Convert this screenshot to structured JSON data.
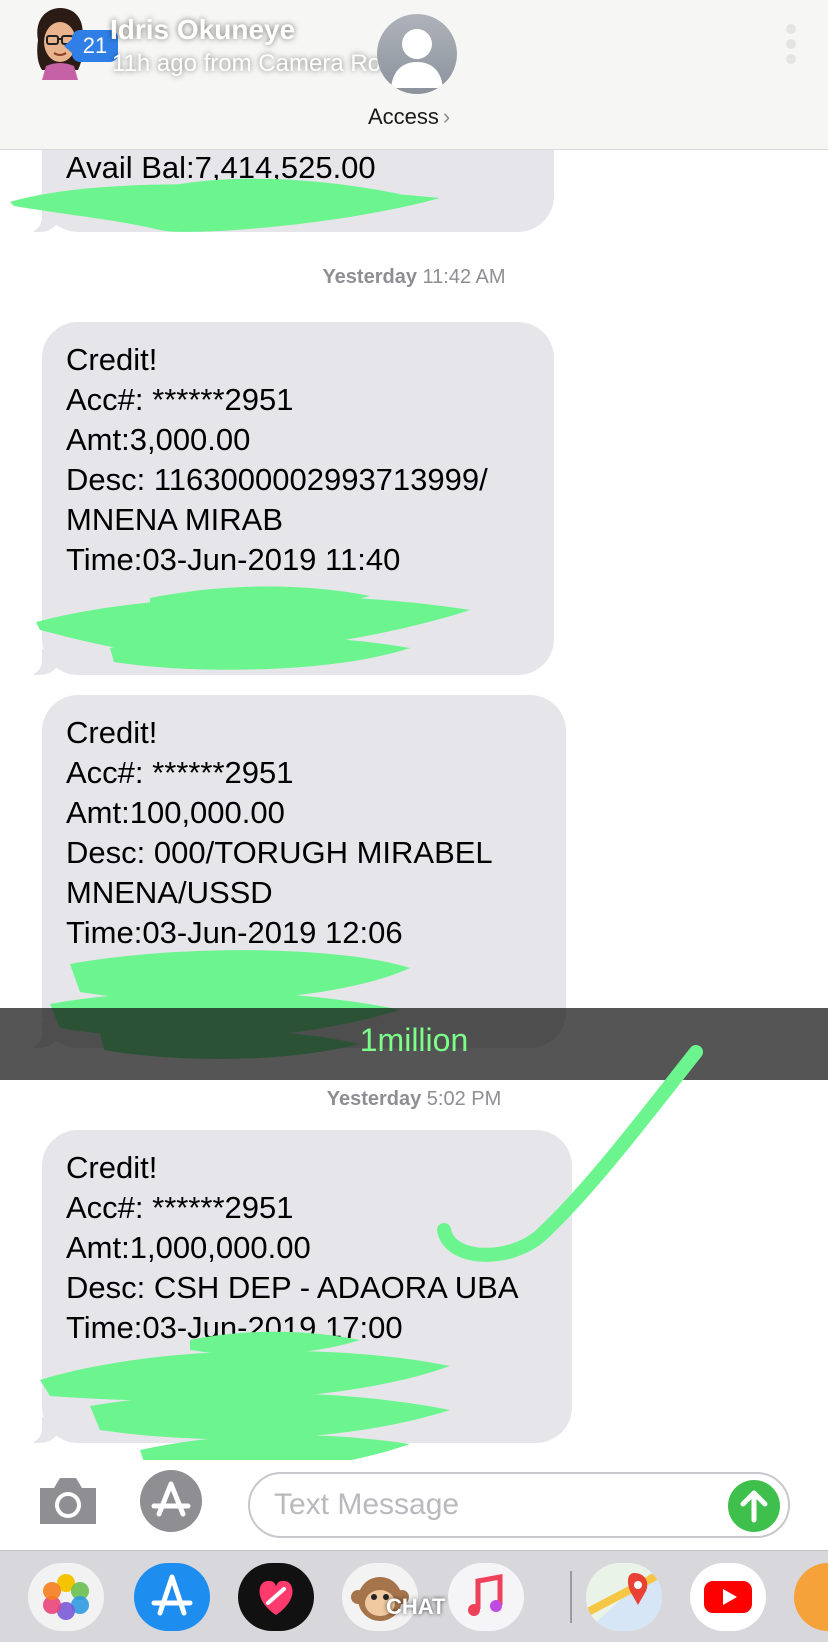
{
  "story": {
    "name": "Idris Okuneye",
    "subtitle": "11h ago from Camera Roll",
    "unread_count": "21",
    "access_label": "Access",
    "access_chevron": "›"
  },
  "conversation": {
    "top_partial": {
      "line": "Avail Bal:7,414,525.00"
    },
    "timestamps": [
      {
        "day": "Yesterday",
        "time": "11:42 AM"
      },
      {
        "day": "Yesterday",
        "time": "5:02 PM"
      }
    ],
    "messages": [
      {
        "lines": [
          "Credit!",
          "Acc#: ******2951",
          "Amt:3,000.00",
          "Desc: 1163000002993713999/",
          "MNENA MIRAB",
          "Time:03-Jun-2019 11:40"
        ]
      },
      {
        "lines": [
          "Credit!",
          "Acc#: ******2951",
          "Amt:100,000.00",
          "Desc: 000/TORUGH  MIRABEL",
          "MNENA/USSD",
          "Time:03-Jun-2019 12:06"
        ]
      },
      {
        "lines": [
          "Credit!",
          "Acc#: ******2951",
          "Amt:1,000,000.00",
          "Desc: CSH DEP - ADAORA UBA",
          "Time:03-Jun-2019 17:00"
        ]
      }
    ]
  },
  "caption": {
    "text": "1million"
  },
  "composer": {
    "placeholder": "Text Message"
  },
  "app_strip": {
    "chat_label": "CHAT",
    "apps": [
      "photos-icon",
      "app-store-icon",
      "digital-touch-icon",
      "animoji-icon",
      "music-icon",
      "maps-icon",
      "youtube-icon"
    ]
  },
  "colors": {
    "bubble": "#e5e5ea",
    "scribble_green": "#6cf58e",
    "caption_green": "#7cff88",
    "send_green": "#3fbf4b",
    "badge_blue": "#2f7fe6"
  }
}
